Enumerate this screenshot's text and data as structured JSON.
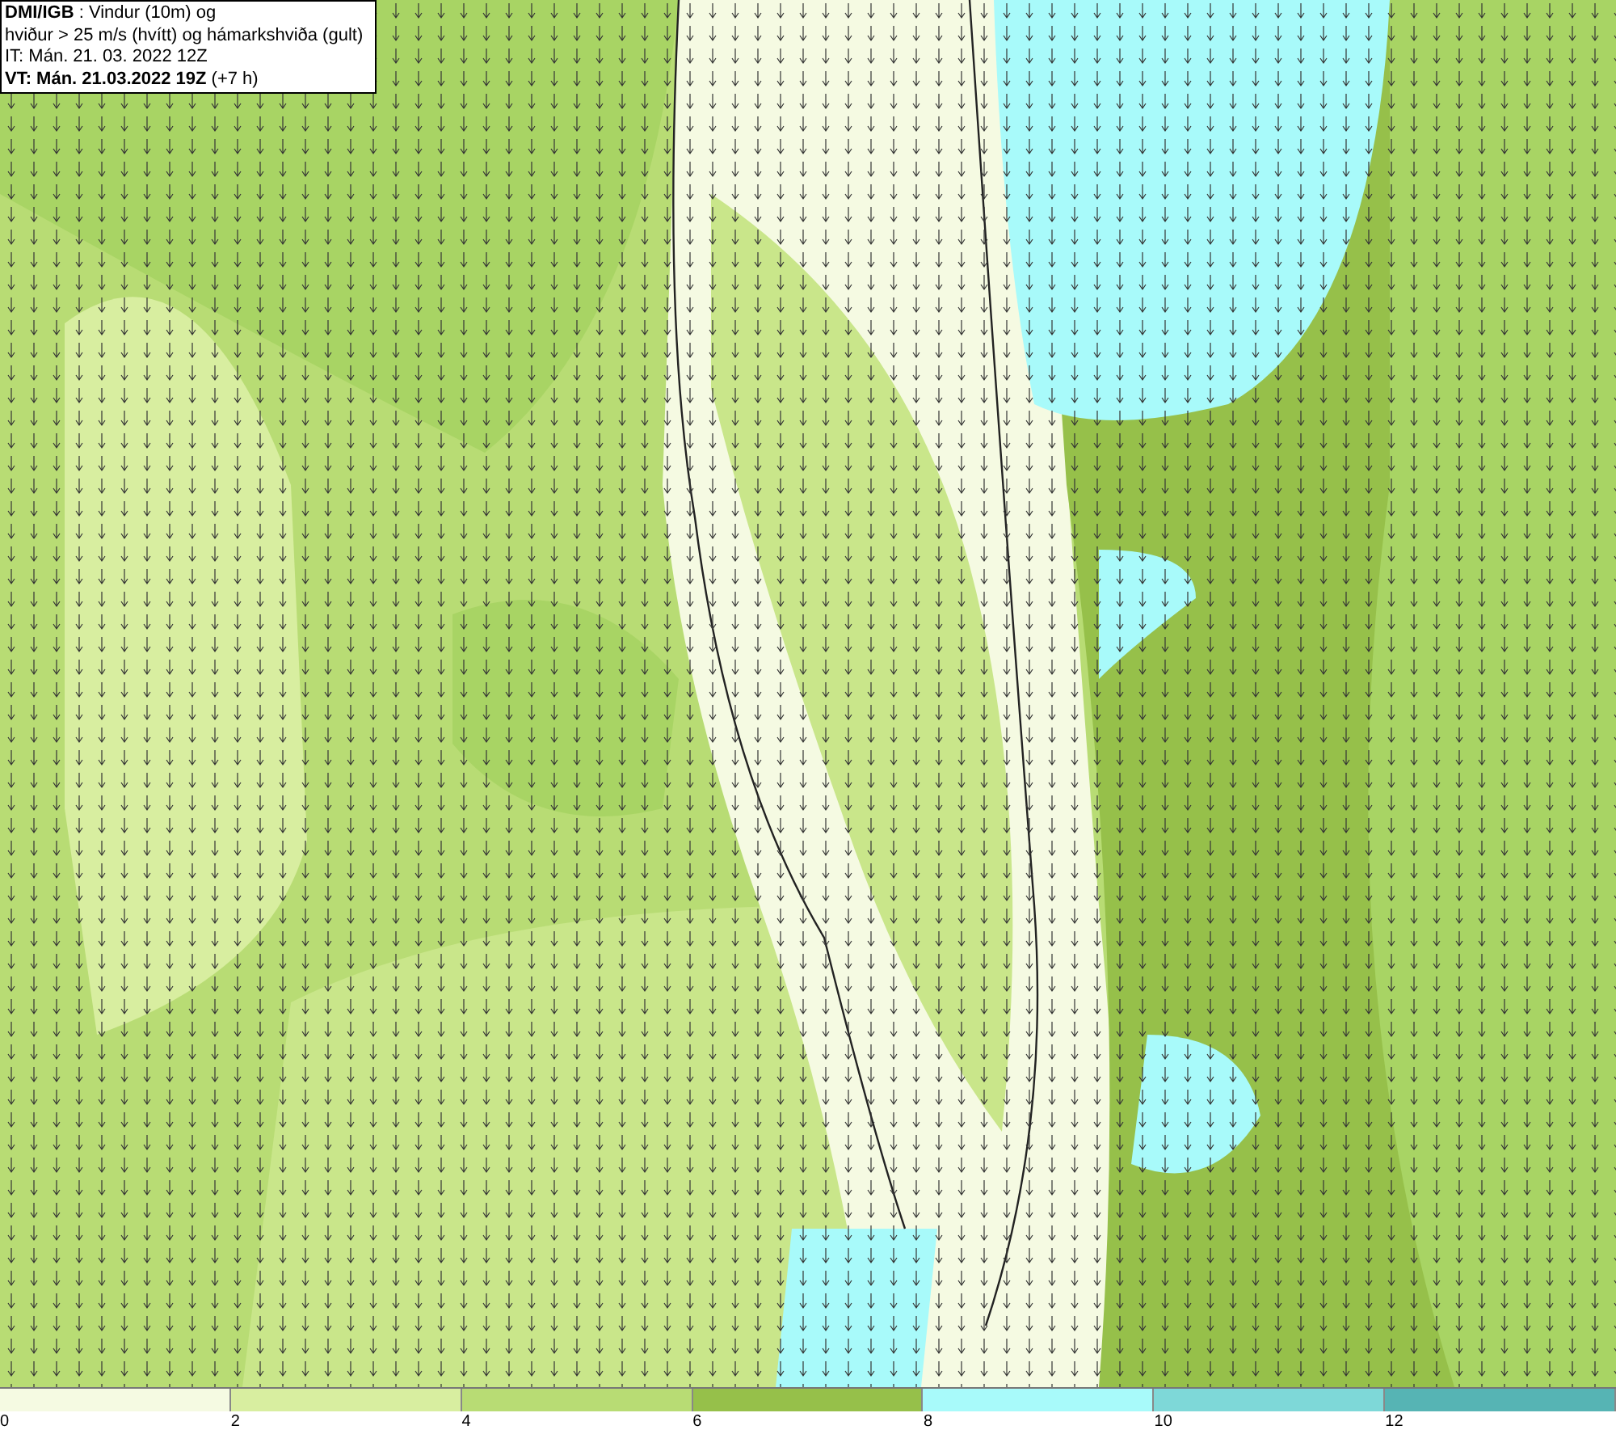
{
  "title_box": {
    "lines": [
      "**DMI/IGB** : Vindur (10m) og",
      "hviður > 25 m/s (hvítt) og hámarkshviða (gult)",
      "IT: Mán. 21. 03. 2022 12Z",
      "**VT: Mán. 21.03.2022 19Z** (+7 h)"
    ]
  },
  "legend": {
    "segments": [
      {
        "color": "#f5fae2"
      },
      {
        "color": "#d8eea0"
      },
      {
        "color": "#b8dc74"
      },
      {
        "color": "#96c04a"
      },
      {
        "color": "#a8fafa"
      },
      {
        "color": "#7ed8d8"
      },
      {
        "color": "#56b4b4"
      }
    ],
    "ticks": [
      "0",
      "2",
      "4",
      "6",
      "8",
      "10",
      "12"
    ]
  }
}
